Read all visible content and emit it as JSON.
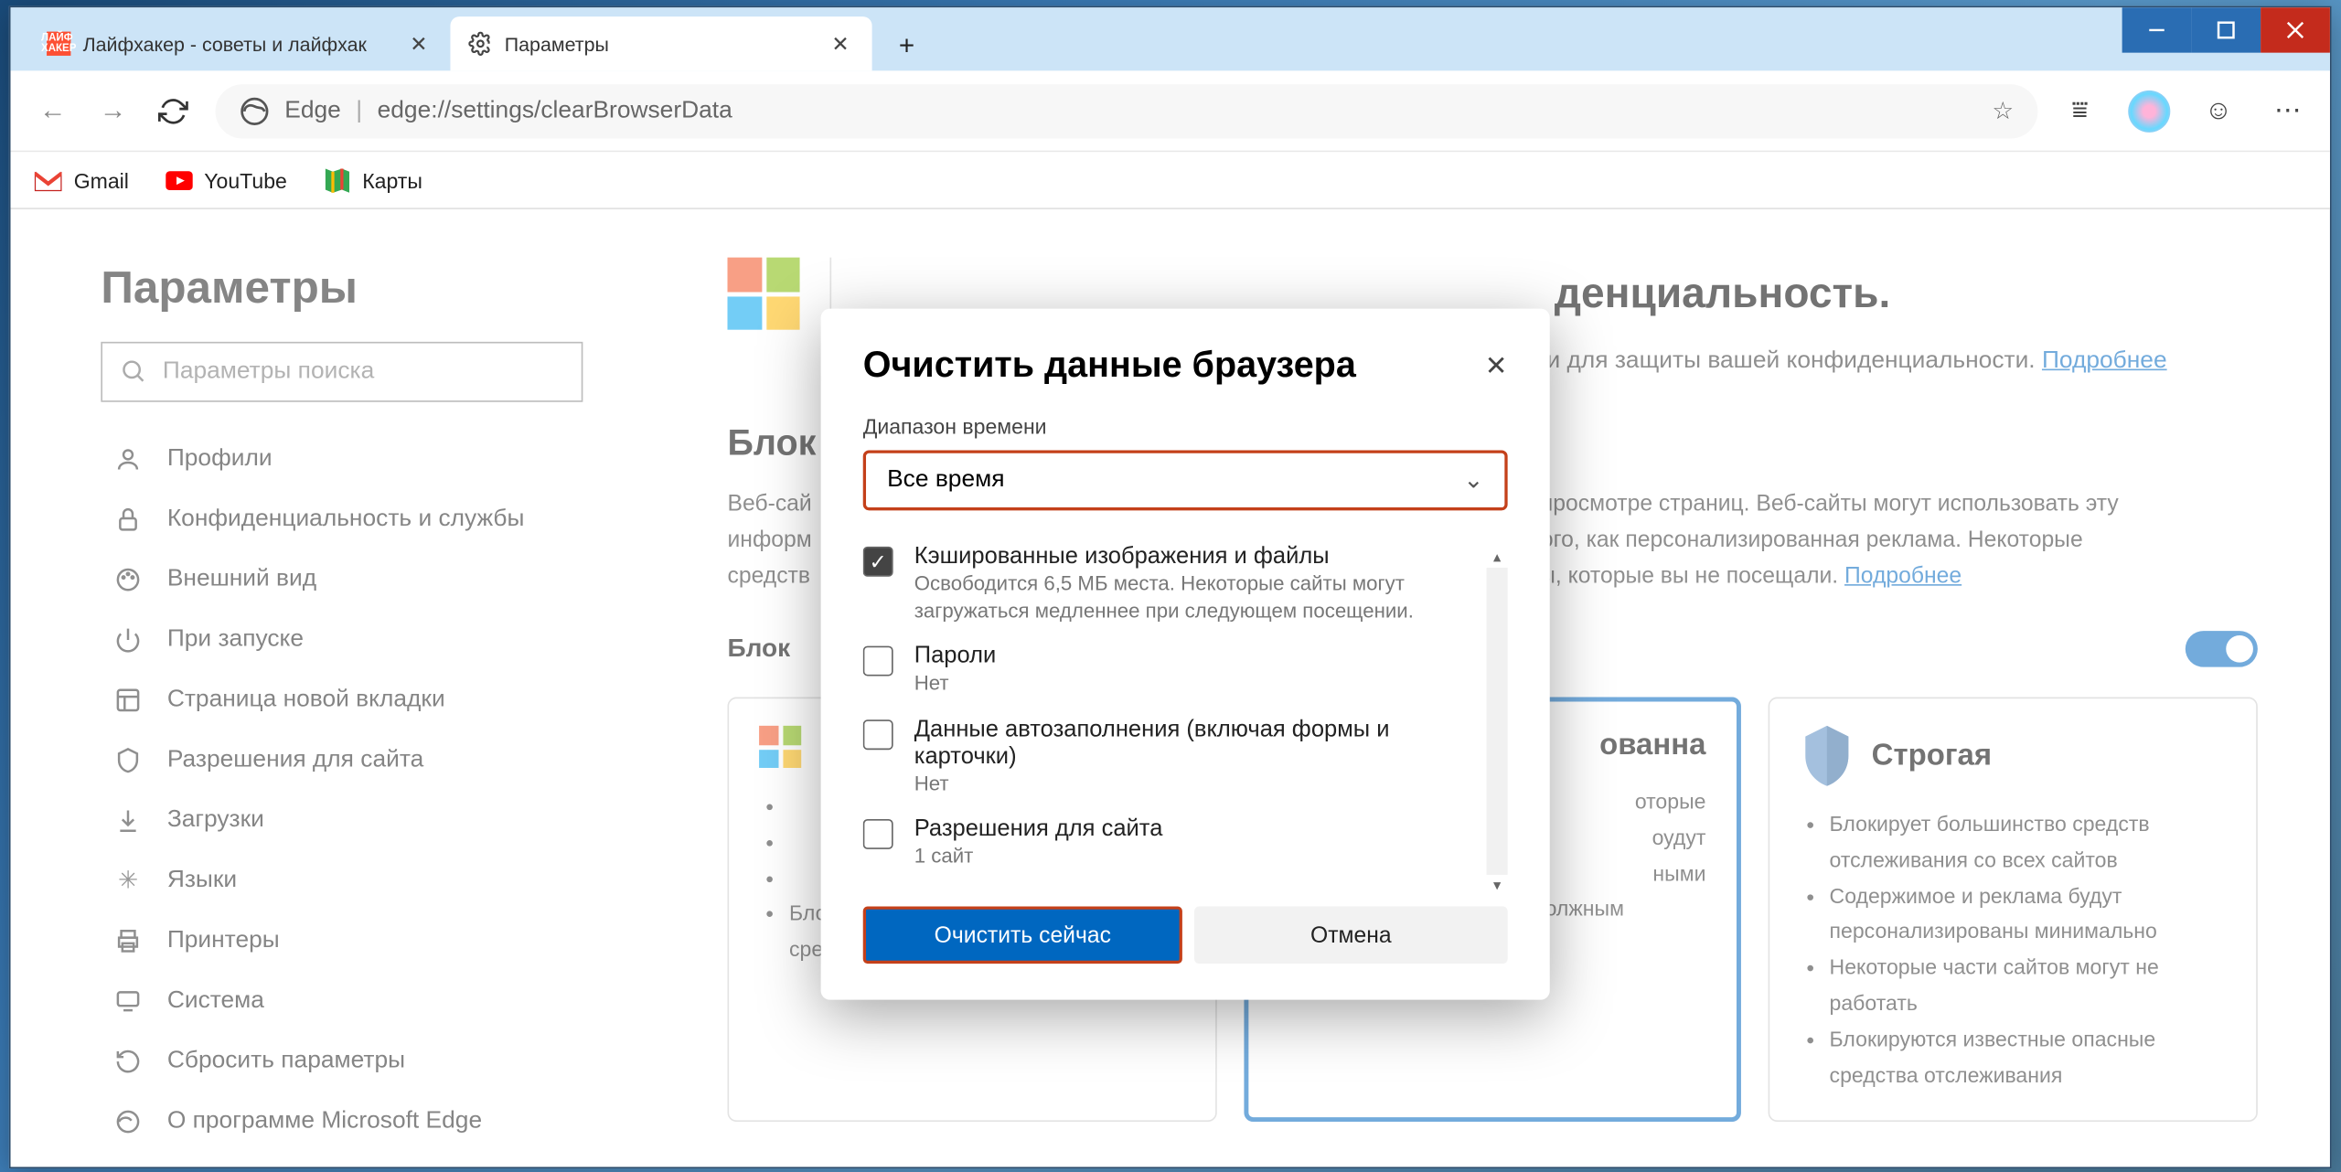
{
  "tabs": [
    {
      "label": "Лайфхакер - советы и лайфхак",
      "icon": "ЛАЙФ\nХАКЕР"
    },
    {
      "label": "Параметры"
    }
  ],
  "titlebar": {
    "min": "—",
    "max": "□",
    "close": "✕",
    "newtab": "+"
  },
  "toolbar": {
    "edge_label": "Edge",
    "url": "edge://settings/clearBrowserData"
  },
  "bookmarks": [
    {
      "label": "Gmail"
    },
    {
      "label": "YouTube"
    },
    {
      "label": "Карты"
    }
  ],
  "sidebar": {
    "title": "Параметры",
    "search_placeholder": "Параметры поиска",
    "items": [
      {
        "label": "Профили",
        "icon": "user"
      },
      {
        "label": "Конфиденциальность и службы",
        "icon": "lock"
      },
      {
        "label": "Внешний вид",
        "icon": "palette"
      },
      {
        "label": "При запуске",
        "icon": "power"
      },
      {
        "label": "Страница новой вкладки",
        "icon": "grid"
      },
      {
        "label": "Разрешения для сайта",
        "icon": "shield"
      },
      {
        "label": "Загрузки",
        "icon": "download"
      },
      {
        "label": "Языки",
        "icon": "lang"
      },
      {
        "label": "Принтеры",
        "icon": "printer"
      },
      {
        "label": "Система",
        "icon": "system"
      },
      {
        "label": "Сбросить параметры",
        "icon": "reset"
      },
      {
        "label": "О программе Microsoft Edge",
        "icon": "edge"
      }
    ]
  },
  "main": {
    "title_suffix": "денциальность.",
    "subtitle_suffix": "и для защиты вашей конфиденциальности. ",
    "learn_more": "Подробнее",
    "section_title": "Блок",
    "section_desc_p1": "Веб-сай",
    "section_desc_p2": "просмотре страниц. Веб-сайты могут использовать эту",
    "section_desc_l2a": "информ",
    "section_desc_l2b": "ого, как персонализированная реклама. Некоторые",
    "section_desc_l3a": "средств",
    "section_desc_l3b": "ы, которые вы не посещали. ",
    "block_label": "Блок",
    "card2_title": "ованна",
    "card2_b1": "оторые",
    "card2_b2": "оудут",
    "card2_b3": "ными",
    "card2_b4": "Сайты будут работать должным образом",
    "card1_b1": "Блокируются известные опасные средства отслеживания",
    "card3_title": "Строгая",
    "card3_b1": "Блокирует большинство средств отслеживания со всех сайтов",
    "card3_b2": "Содержимое и реклама будут персонализированы минимально",
    "card3_b3": "Некоторые части сайтов могут не работать",
    "card3_b4": "Блокируются известные опасные средства отслеживания"
  },
  "dialog": {
    "title": "Очистить данные браузера",
    "close": "✕",
    "range_label": "Диапазон времени",
    "range_value": "Все время",
    "options": [
      {
        "checked": true,
        "title": "Кэшированные изображения и файлы",
        "sub": "Освободится 6,5 МБ места. Некоторые сайты могут загружаться медленнее при следующем посещении."
      },
      {
        "checked": false,
        "title": "Пароли",
        "sub": "Нет"
      },
      {
        "checked": false,
        "title": "Данные автозаполнения (включая формы и карточки)",
        "sub": "Нет"
      },
      {
        "checked": false,
        "title": "Разрешения для сайта",
        "sub": "1 сайт"
      }
    ],
    "primary": "Очистить сейчас",
    "cancel": "Отмена"
  }
}
